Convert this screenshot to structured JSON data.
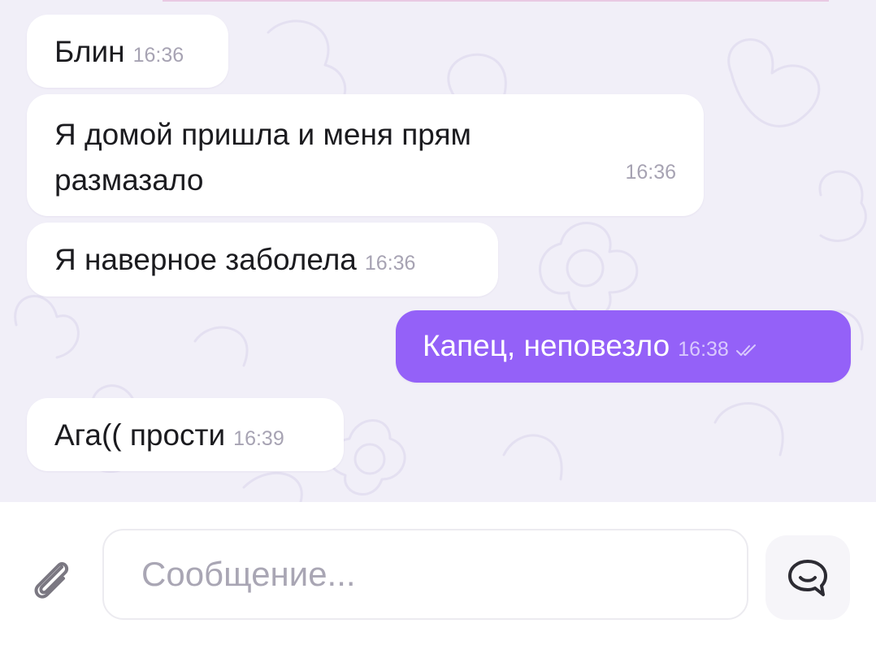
{
  "messages": [
    {
      "direction": "in",
      "text": "Блин",
      "time": "16:36"
    },
    {
      "direction": "in",
      "lines": [
        "Я домой пришла и меня прям",
        "размазало"
      ],
      "time": "16:36"
    },
    {
      "direction": "in",
      "text": "Я наверное заболела",
      "time": "16:36"
    },
    {
      "direction": "out",
      "text": "Капец, неповезло",
      "time": "16:38",
      "status_icon": "double-check-icon"
    },
    {
      "direction": "in",
      "text": "Ага(( прости",
      "time": "16:39"
    }
  ],
  "composer": {
    "placeholder": "Сообщение...",
    "value": "",
    "attach_icon": "paperclip-icon",
    "action_icon": "chat-bubble-icon"
  },
  "colors": {
    "chat_background": "#f1eff8",
    "incoming_bubble": "#ffffff",
    "outgoing_bubble": "#9461f8",
    "time_text": "#a7a3b3",
    "placeholder": "#a9a6b4"
  }
}
